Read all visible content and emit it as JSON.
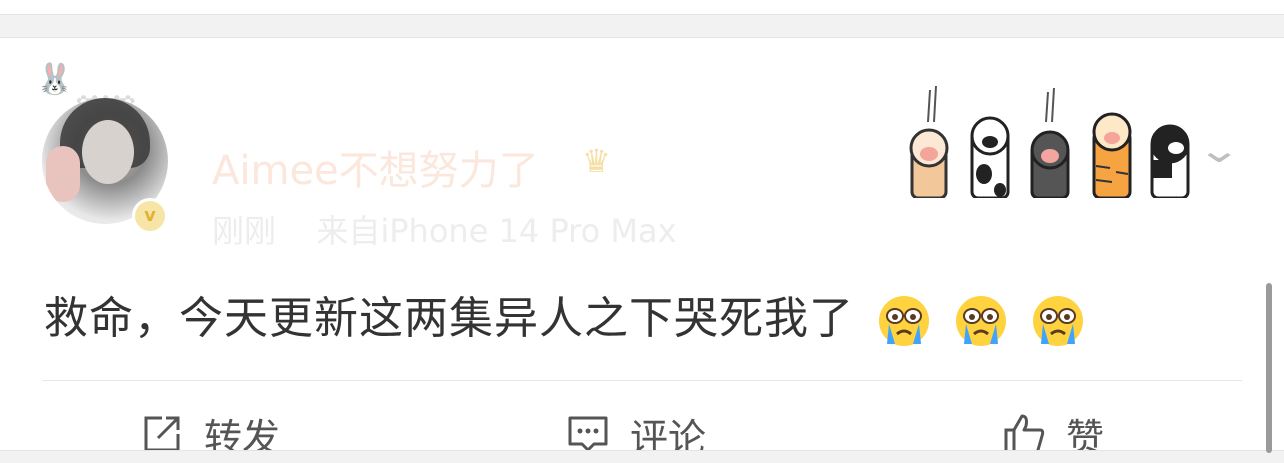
{
  "post": {
    "username": "Aimee不想努力了",
    "crown_icon": "crown-icon",
    "time": "刚刚",
    "source": "来自iPhone 14 Pro Max",
    "text": "救命，今天更新这两集异人之下哭死我了",
    "emojis": [
      "crying-face-emoji",
      "crying-face-emoji",
      "crying-face-emoji"
    ],
    "verified_icon": "verified-v-icon"
  },
  "actions": {
    "repost_label": "转发",
    "comment_label": "评论",
    "like_label": "赞"
  },
  "colors": {
    "username": "#fbe7dc",
    "text": "#333333",
    "action": "#555555",
    "meta": "#ededed"
  }
}
